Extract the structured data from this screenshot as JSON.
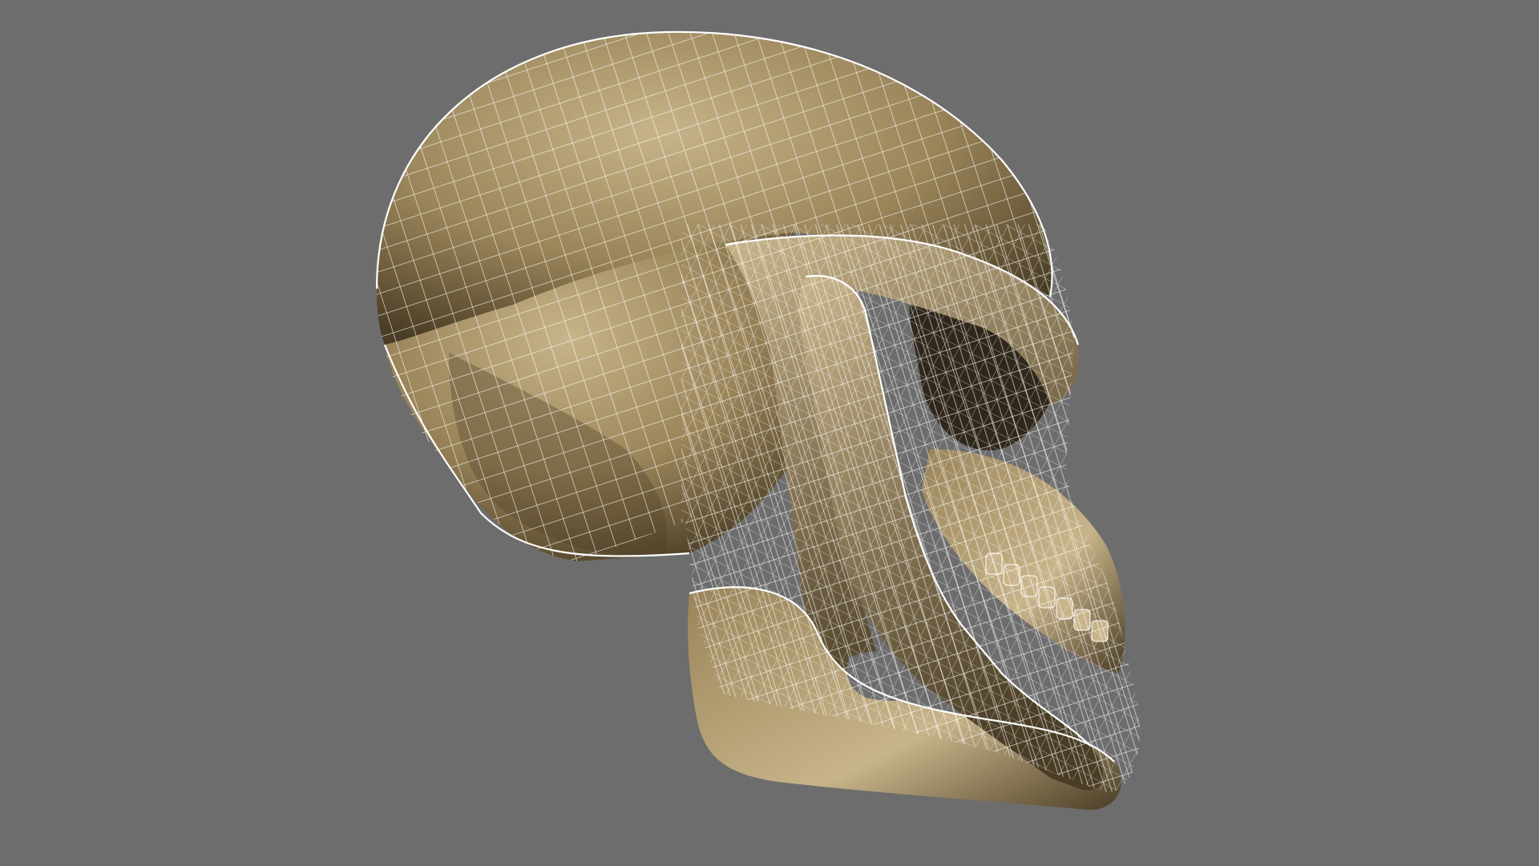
{
  "viewport": {
    "background_color": "#6d6d6d",
    "shading": "textured-with-wireframe"
  },
  "model": {
    "subject": "primate-skull",
    "material_colors": {
      "base": "#9a8459",
      "light": "#c8b48a",
      "dark": "#4a3d25",
      "shadow": "#2f271a"
    },
    "wireframe_color": "#ffffff",
    "wireframe_opacity": 0.85
  }
}
